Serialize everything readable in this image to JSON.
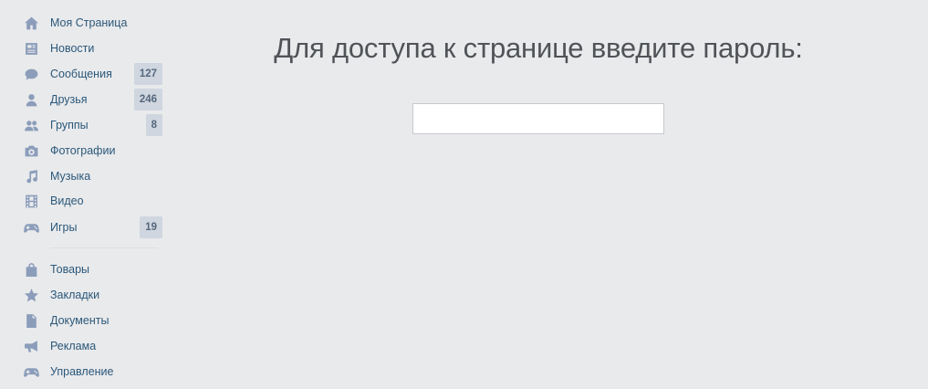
{
  "sidebar": {
    "items": [
      {
        "label": "Моя Страница",
        "icon": "home-icon"
      },
      {
        "label": "Новости",
        "icon": "news-icon"
      },
      {
        "label": "Сообщения",
        "icon": "messages-icon",
        "badge": "127"
      },
      {
        "label": "Друзья",
        "icon": "friends-icon",
        "badge": "246"
      },
      {
        "label": "Группы",
        "icon": "groups-icon",
        "badge": "8"
      },
      {
        "label": "Фотографии",
        "icon": "camera-icon"
      },
      {
        "label": "Музыка",
        "icon": "music-icon"
      },
      {
        "label": "Видео",
        "icon": "video-icon"
      },
      {
        "label": "Игры",
        "icon": "gamepad-icon",
        "badge": "19"
      }
    ],
    "extra_items": [
      {
        "label": "Товары",
        "icon": "shopping-bag-icon"
      },
      {
        "label": "Закладки",
        "icon": "star-icon"
      },
      {
        "label": "Документы",
        "icon": "document-icon"
      },
      {
        "label": "Реклама",
        "icon": "megaphone-icon"
      },
      {
        "label": "Управление",
        "icon": "gamepad-icon"
      }
    ]
  },
  "main": {
    "title": "Для доступа к странице введите пароль:",
    "password_value": ""
  },
  "colors": {
    "background": "#e9eaec",
    "link": "#2b587a",
    "icon": "#8b9dba",
    "badge_bg": "#cfd6df"
  }
}
